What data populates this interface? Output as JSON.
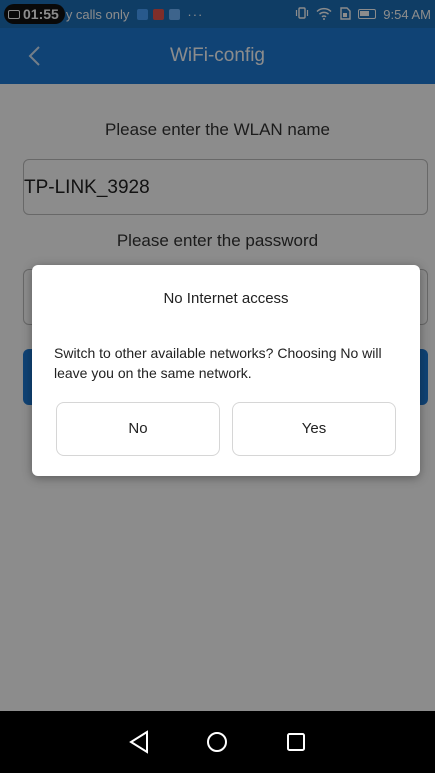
{
  "status_bar": {
    "recording_time": "01:55",
    "carrier_text": "y calls only",
    "more": "···",
    "clock": "9:54 AM"
  },
  "app_bar": {
    "title": "WiFi-config",
    "back_icon": "back-arrow-icon"
  },
  "form": {
    "wlan_label": "Please enter the WLAN name",
    "ssid_value": "TP-LINK_3928",
    "password_label": "Please enter the password",
    "password_value": ""
  },
  "dialog": {
    "title": "No Internet access",
    "message": "Switch to other available networks? Choosing No will leave you on the same network.",
    "no_label": "No",
    "yes_label": "Yes"
  },
  "colors": {
    "primary": "#1e7ad6",
    "status_bar": "#1c6fb8"
  }
}
